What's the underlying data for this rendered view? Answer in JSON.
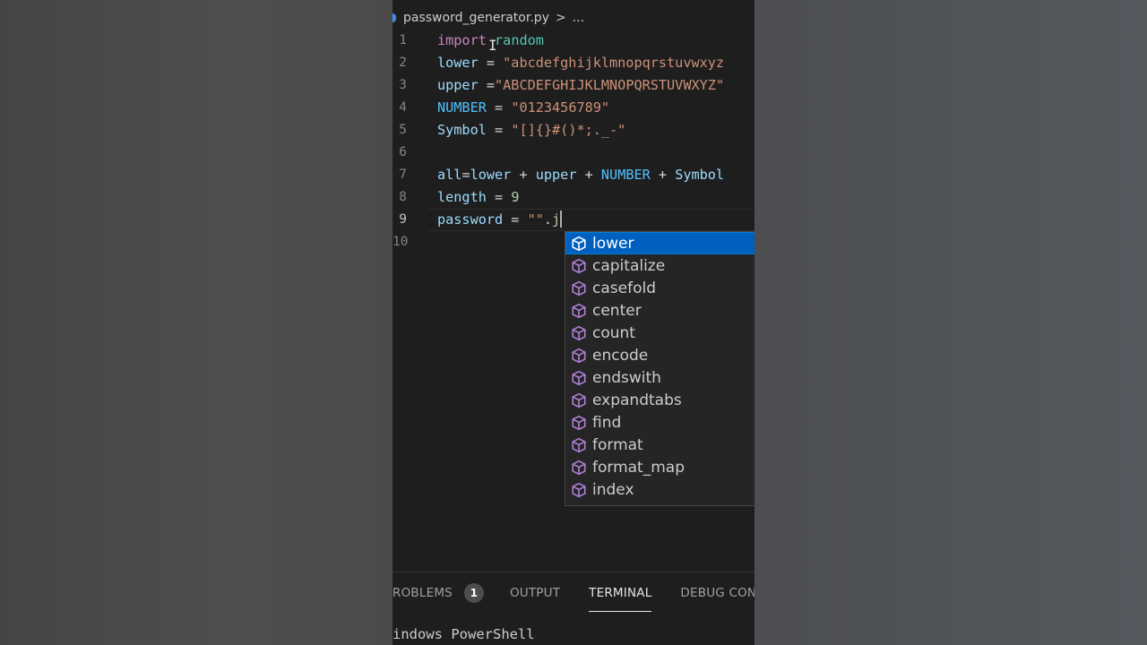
{
  "breadcrumb": {
    "file": "password_generator.py",
    "separator": ">",
    "more": "..."
  },
  "code_lines": [
    {
      "number": "1"
    },
    {
      "number": "2"
    },
    {
      "number": "3"
    },
    {
      "number": "4"
    },
    {
      "number": "5"
    },
    {
      "number": "6"
    },
    {
      "number": "7"
    },
    {
      "number": "8"
    },
    {
      "number": "9"
    },
    {
      "number": "10"
    }
  ],
  "code": {
    "l1": {
      "kw": "import",
      "mod": "random"
    },
    "l2": {
      "var": "lower",
      "op": " = ",
      "str": "\"abcdefghijklmnopqrstuvwxyz"
    },
    "l3": {
      "var": "upper",
      "op": " =",
      "str": "\"ABCDEFGHIJKLMNOPQRSTUVWXYZ\""
    },
    "l4": {
      "var": "NUMBER",
      "op": " = ",
      "str": "\"0123456789\""
    },
    "l5": {
      "var": "Symbol",
      "op": " = ",
      "str": "\"[]{}#()*;._-\""
    },
    "l7": {
      "a": "all",
      "eq": "=",
      "b": "lower",
      "p1": " + ",
      "c": "upper",
      "p2": " + ",
      "d": "NUMBER",
      "p3": " + ",
      "e": "Symbol"
    },
    "l8": {
      "var": "length",
      "op": " = ",
      "num": "9"
    },
    "l9": {
      "var": "password",
      "op": " = ",
      "str": "\"\"",
      "dot": ".",
      "typed": "j"
    }
  },
  "suggestions": [
    {
      "label": "lower",
      "icon": "method-cube-icon",
      "selected": true
    },
    {
      "label": "capitalize",
      "icon": "method-cube-icon"
    },
    {
      "label": "casefold",
      "icon": "method-cube-icon"
    },
    {
      "label": "center",
      "icon": "method-cube-icon"
    },
    {
      "label": "count",
      "icon": "method-cube-icon"
    },
    {
      "label": "encode",
      "icon": "method-cube-icon"
    },
    {
      "label": "endswith",
      "icon": "method-cube-icon"
    },
    {
      "label": "expandtabs",
      "icon": "method-cube-icon"
    },
    {
      "label": "find",
      "icon": "method-cube-icon"
    },
    {
      "label": "format",
      "icon": "method-cube-icon"
    },
    {
      "label": "format_map",
      "icon": "method-cube-icon"
    },
    {
      "label": "index",
      "icon": "method-cube-icon"
    }
  ],
  "panel_tabs": {
    "problems": "ROBLEMS",
    "problems_count": "1",
    "output": "OUTPUT",
    "terminal": "TERMINAL",
    "debug": "DEBUG CONSC"
  },
  "terminal": {
    "text": "indows PowerShell"
  },
  "colors": {
    "editor_bg": "#1e1e1e",
    "keyword": "#c586c0",
    "module": "#4ec9b0",
    "variable": "#9cdcfe",
    "constant": "#4fc1ff",
    "string": "#ce9178",
    "number": "#b5cea8",
    "selected_suggestion": "#0060c0",
    "method_icon": "#b180d7"
  }
}
